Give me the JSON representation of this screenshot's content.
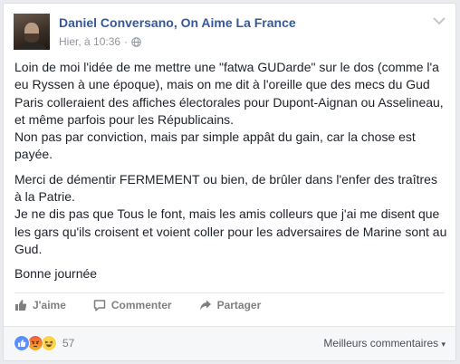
{
  "post": {
    "author": "Daniel Conversano, On Aime La France",
    "timestamp": "Hier, à 10:36",
    "separator": "·",
    "privacy_icon": "globe-icon",
    "menu_icon": "chevron-down-icon",
    "paragraphs": [
      "Loin de moi l'idée de me mettre une \"fatwa GUDarde\" sur le dos (comme l'a eu Ryssen à une époque), mais on me dit à l'oreille que des mecs du Gud Paris colleraient des affiches électorales pour Dupont-Aignan ou Asselineau, et même parfois pour les Républicains.\nNon pas par conviction, mais par simple appât du gain, car la chose est payée.",
      "Merci de démentir FERMEMENT ou bien, de brûler dans l'enfer des traîtres à la Patrie.\nJe ne dis pas que Tous le font, mais les amis colleurs que j'ai me disent que les gars qu'ils croisent et voient coller pour les adversaires de Marine sont au Gud.",
      "Bonne journée"
    ]
  },
  "actions": {
    "like_label": "J'aime",
    "comment_label": "Commenter",
    "share_label": "Partager"
  },
  "reactions": {
    "types": [
      "like",
      "angry",
      "haha"
    ],
    "count": "57",
    "colors": {
      "like": "#5890ff",
      "angry": "#f0593b",
      "haha": "#fcd34d"
    }
  },
  "comments": {
    "sort_label": "Meilleurs commentaires",
    "sort_icon": "caret-down"
  },
  "theme": {
    "link_color": "#365899",
    "text_color": "#1d2129",
    "muted_color": "#90949c"
  }
}
